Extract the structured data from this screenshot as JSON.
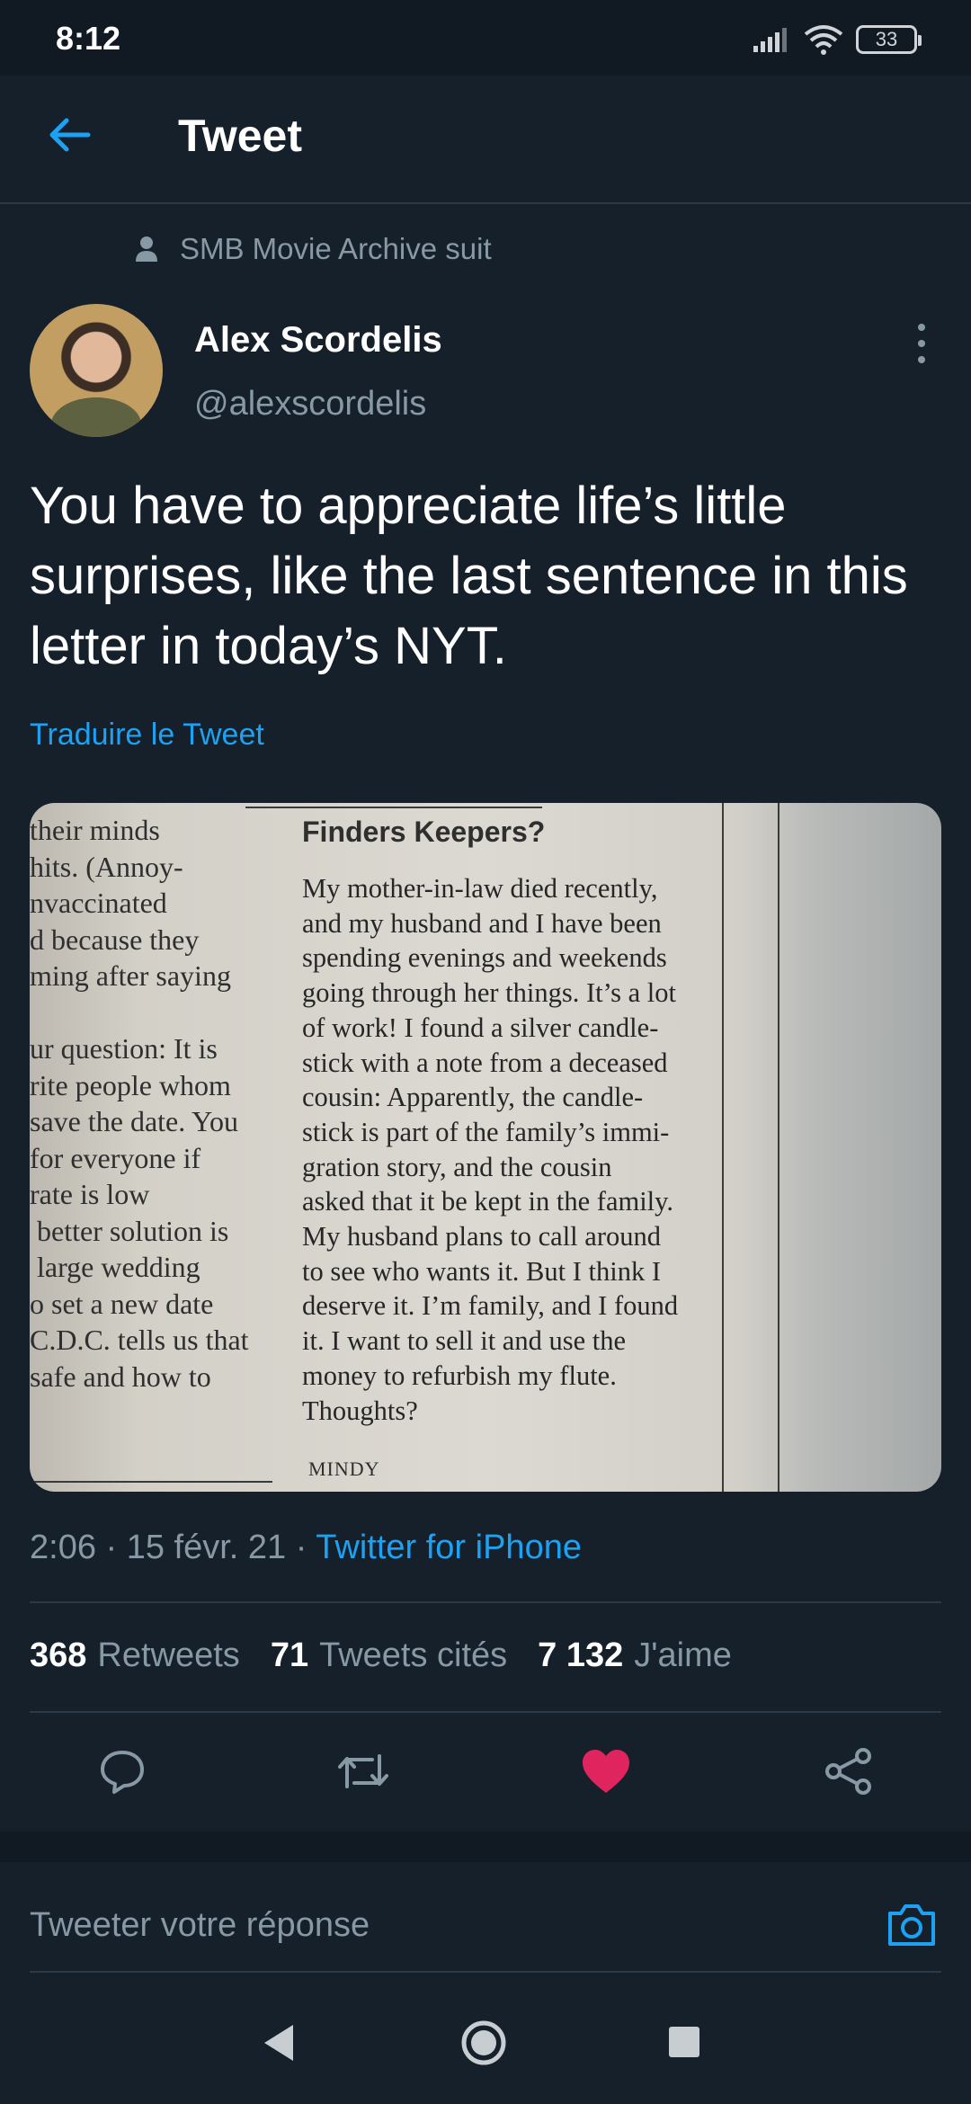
{
  "status_bar": {
    "time": "8:12",
    "battery": "33",
    "icons": [
      "signal-icon",
      "wifi-icon",
      "battery-icon"
    ]
  },
  "header": {
    "title": "Tweet",
    "back_icon": "arrow-left-icon"
  },
  "tweet": {
    "social_context": "SMB Movie Archive suit",
    "author_name": "Alex Scordelis",
    "author_handle": "@alexscordelis",
    "text": "You have to appreciate life’s little surprises, like the last sentence in this letter in today’s NYT.",
    "translate_label": "Traduire le Tweet",
    "timestamp": "2:06 · 15 févr. 21 · ",
    "source": "Twitter for iPhone"
  },
  "media": {
    "left_column_lines": [
      "their minds",
      "hits. (Annoy-",
      "nvaccinated",
      "d because they",
      "ming after saying",
      "",
      "ur question: It is",
      "rite people whom",
      "save the date. You",
      "for everyone if",
      "rate is low",
      " better solution is",
      " large wedding",
      "o set a new date",
      "C.D.C. tells us that",
      "safe and how to"
    ],
    "letter_title": "Finders Keepers?",
    "letter_lines": [
      "My mother-in-law died recently,",
      "and my husband and I have been",
      "spending evenings and weekends",
      "going through her things. It’s a lot",
      "of work! I found a silver candle-",
      "stick with a note from a deceased",
      "cousin: Apparently, the candle-",
      "stick is part of the family’s immi-",
      "gration story, and the cousin",
      "asked that it be kept in the family.",
      "My husband plans to call around",
      "to see who wants it. But I think I",
      "deserve it. I’m family, and I found",
      "it. I want to sell it and use the",
      "money to refurbish my flute.",
      "Thoughts?"
    ],
    "letter_signature": "MINDY"
  },
  "stats": {
    "retweets_count": "368",
    "retweets_label": "Retweets",
    "quotes_count": "71",
    "quotes_label": "Tweets cités",
    "likes_count": "7 132",
    "likes_label": "J'aime"
  },
  "actions": [
    "reply-icon",
    "retweet-icon",
    "like-icon",
    "share-icon"
  ],
  "colors": {
    "background": "#15202b",
    "accent": "#1da1f2",
    "like": "#e0245e",
    "secondary_text": "#8899a6"
  },
  "reply": {
    "placeholder": "Tweeter votre réponse"
  }
}
